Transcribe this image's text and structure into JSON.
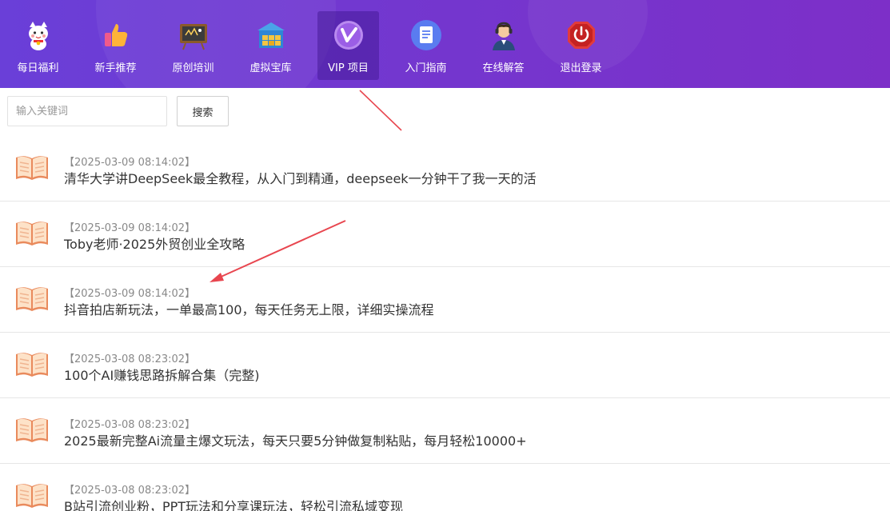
{
  "nav": {
    "items": [
      {
        "label": "每日福利",
        "icon": "lucky-cat-icon"
      },
      {
        "label": "新手推荐",
        "icon": "thumbs-up-icon"
      },
      {
        "label": "原创培训",
        "icon": "blackboard-icon"
      },
      {
        "label": "虚拟宝库",
        "icon": "warehouse-icon"
      },
      {
        "label": "VIP 项目",
        "icon": "vip-icon",
        "active": true
      },
      {
        "label": "入门指南",
        "icon": "document-icon"
      },
      {
        "label": "在线解答",
        "icon": "support-agent-icon"
      },
      {
        "label": "退出登录",
        "icon": "power-icon"
      }
    ]
  },
  "search": {
    "placeholder": "输入关键词",
    "value": "",
    "button_label": "搜索"
  },
  "articles": [
    {
      "date": "【2025-03-09 08:14:02】",
      "title": "清华大学讲DeepSeek最全教程，从入门到精通，deepseek一分钟干了我一天的活"
    },
    {
      "date": "【2025-03-09 08:14:02】",
      "title": "Toby老师·2025外贸创业全攻略"
    },
    {
      "date": "【2025-03-09 08:14:02】",
      "title": "抖音拍店新玩法，一单最高100，每天任务无上限，详细实操流程"
    },
    {
      "date": "【2025-03-08 08:23:02】",
      "title": "100个AI赚钱思路拆解合集（完整)"
    },
    {
      "date": "【2025-03-08 08:23:02】",
      "title": "2025最新完整Ai流量主爆文玩法，每天只要5分钟做复制粘贴，每月轻松10000+"
    },
    {
      "date": "【2025-03-08 08:23:02】",
      "title": "B站引流创业粉，PPT玩法和分享课玩法，轻松引流私域变现"
    }
  ],
  "colors": {
    "nav_start": "#6a3fd8",
    "nav_end": "#7d2fc8",
    "annotation_arrow": "#e8464f",
    "book_icon": "#f0a070"
  }
}
